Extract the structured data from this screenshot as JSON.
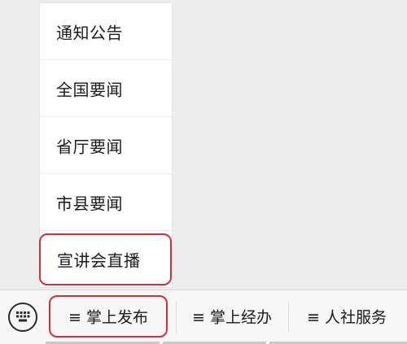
{
  "menu": {
    "items": [
      {
        "label": "通知公告"
      },
      {
        "label": "全国要闻"
      },
      {
        "label": "省厅要闻"
      },
      {
        "label": "市县要闻"
      },
      {
        "label": "宣讲会直播"
      }
    ]
  },
  "bottom_bar": {
    "keyboard_icon": "keyboard-icon",
    "menu_glyph": "≡",
    "tabs": [
      {
        "label": "掌上发布"
      },
      {
        "label": "掌上经办"
      },
      {
        "label": "人社服务"
      }
    ]
  },
  "colors": {
    "highlight": "#d0313b",
    "background": "#ededed",
    "menu_background": "#ffffff"
  }
}
